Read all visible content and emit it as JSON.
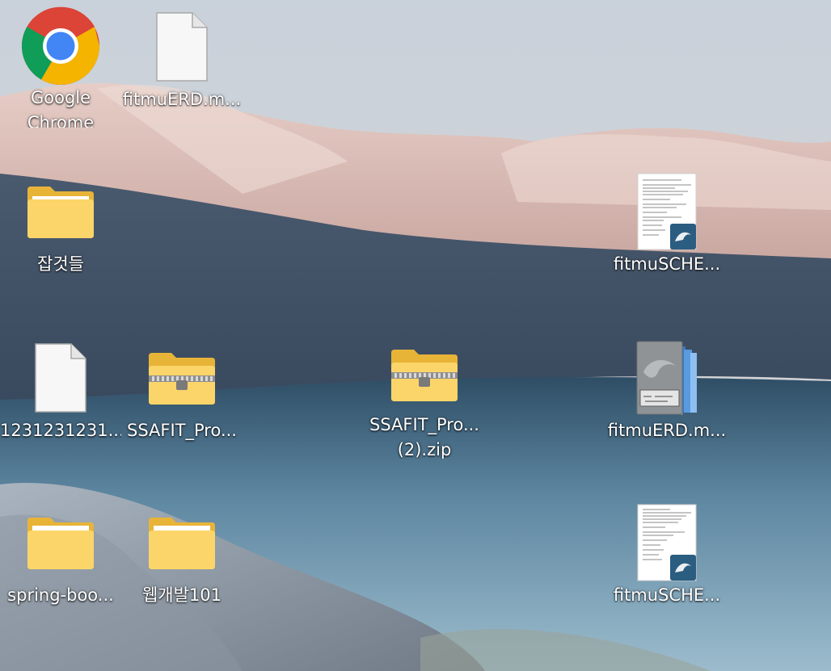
{
  "desktop": {
    "icons": [
      {
        "id": "chrome",
        "lines": [
          "Google",
          "Chrome"
        ],
        "icon": "chrome-icon"
      },
      {
        "id": "file-erd-top",
        "lines": [
          "fitmuERD.m..."
        ],
        "icon": "blank-file-icon"
      },
      {
        "id": "folder-japgeot",
        "lines": [
          "잡것들"
        ],
        "icon": "folder-icon"
      },
      {
        "id": "schema-1",
        "lines": [
          "fitmuSCHE..."
        ],
        "icon": "sql-script-icon"
      },
      {
        "id": "file-123",
        "lines": [
          "1231231231..."
        ],
        "icon": "blank-file-icon"
      },
      {
        "id": "zip-ssafit-1",
        "lines": [
          "SSAFIT_Pro..."
        ],
        "icon": "zip-folder-icon"
      },
      {
        "id": "zip-ssafit-2",
        "lines": [
          "SSAFIT_Pro...",
          "(2).zip"
        ],
        "icon": "zip-folder-icon"
      },
      {
        "id": "erd-workbench",
        "lines": [
          "fitmuERD.m..."
        ],
        "icon": "mysql-workbench-model-icon"
      },
      {
        "id": "folder-spring",
        "lines": [
          "spring-boo..."
        ],
        "icon": "folder-icon"
      },
      {
        "id": "folder-webdev",
        "lines": [
          "웹개발101"
        ],
        "icon": "folder-icon"
      },
      {
        "id": "schema-2",
        "lines": [
          "fitmuSCHE..."
        ],
        "icon": "sql-script-icon"
      }
    ]
  },
  "colors": {
    "folder_back": "#E8B438",
    "folder_front": "#FBD569",
    "chrome_red": "#DB4437",
    "chrome_green": "#0F9D58",
    "chrome_yellow": "#F4B400",
    "chrome_blue": "#4285F4",
    "mysql_badge": "#2B5D80"
  }
}
